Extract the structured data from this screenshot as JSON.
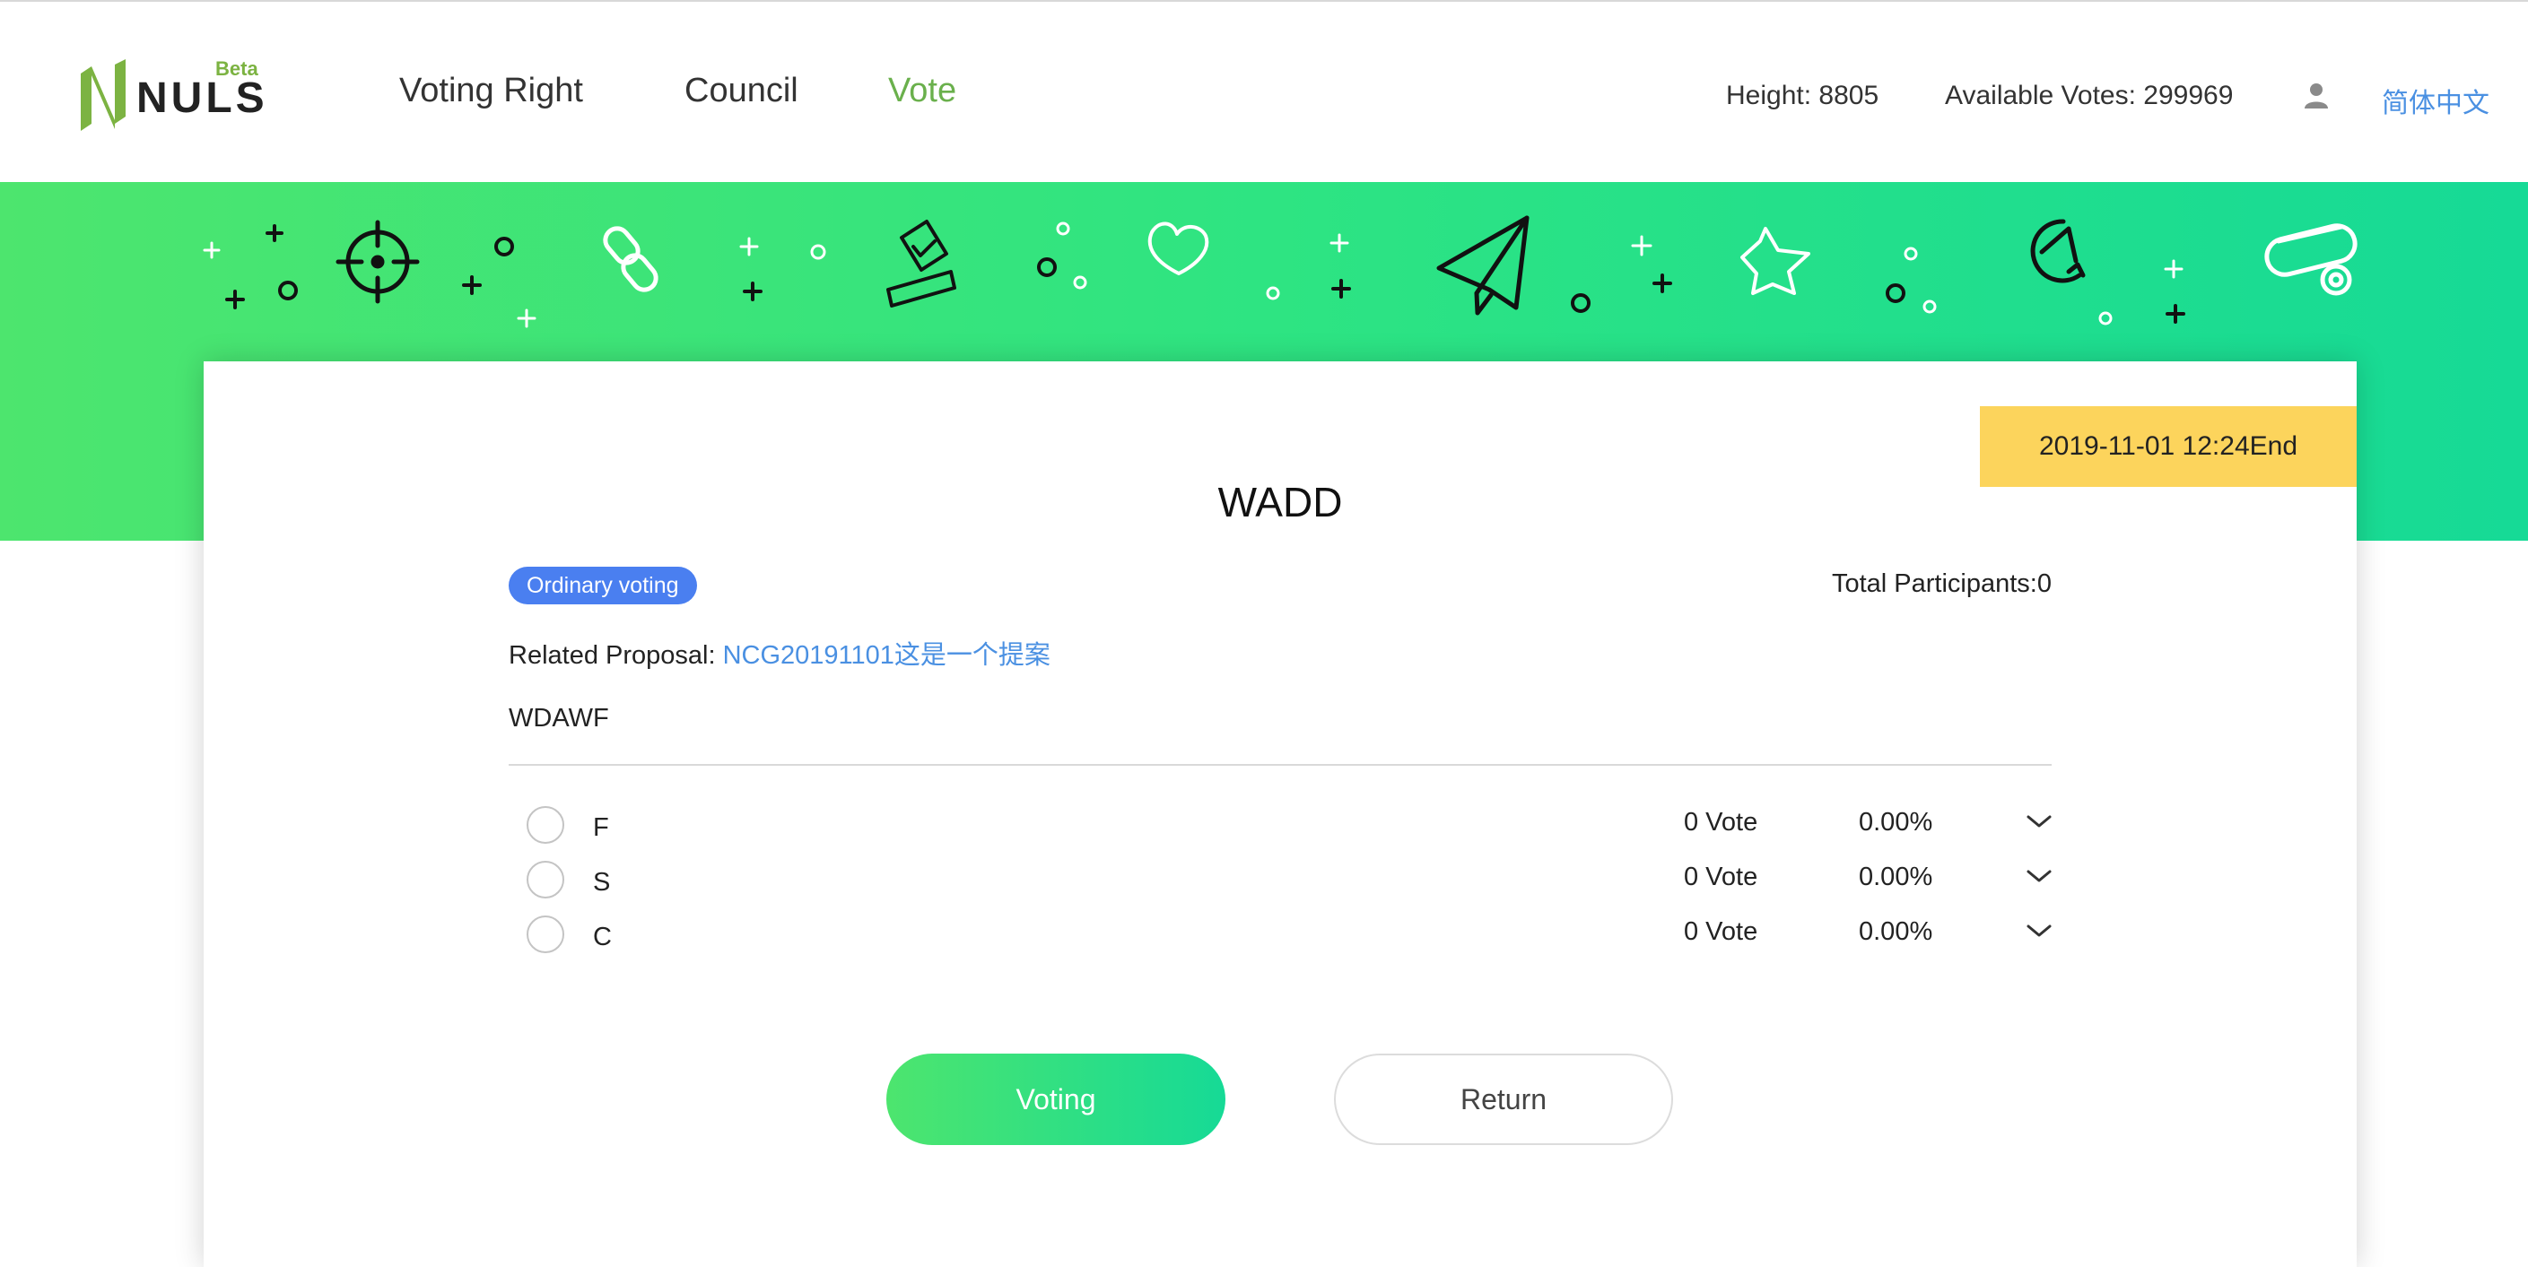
{
  "logo": {
    "text": "NULS",
    "badge": "Beta"
  },
  "nav": {
    "items": [
      {
        "label": "Voting Right"
      },
      {
        "label": "Council"
      },
      {
        "label": "Vote"
      }
    ],
    "active": "Vote"
  },
  "header": {
    "height": "Height: 8805",
    "available_votes": "Available Votes: 299969",
    "language": "简体中文"
  },
  "banner": {
    "icons": [
      "target-icon",
      "link-icon",
      "ballot-icon",
      "heart-icon",
      "paper-plane-icon",
      "star-icon",
      "pie-chart-icon",
      "eraser-icon"
    ]
  },
  "proposal": {
    "end_time": "2019-11-01 12:24End",
    "title": "WADD",
    "type": "Ordinary voting",
    "participants": "Total Participants:0",
    "related_label": "Related Proposal: ",
    "related_link": "NCG20191101这是一个提案",
    "description": "WDAWF",
    "options": [
      {
        "label": "F",
        "votes": "0 Vote",
        "percent": "0.00%"
      },
      {
        "label": "S",
        "votes": "0 Vote",
        "percent": "0.00%"
      },
      {
        "label": "C",
        "votes": "0 Vote",
        "percent": "0.00%"
      }
    ]
  },
  "actions": {
    "vote_label": "Voting",
    "return_label": "Return"
  },
  "colors": {
    "accent_green": "#6ab04c",
    "banner_start": "#4de56e",
    "banner_end": "#16da96",
    "link_blue": "#4a90e2",
    "pill_blue": "#4a7ff0",
    "end_badge": "#fcd45c"
  }
}
